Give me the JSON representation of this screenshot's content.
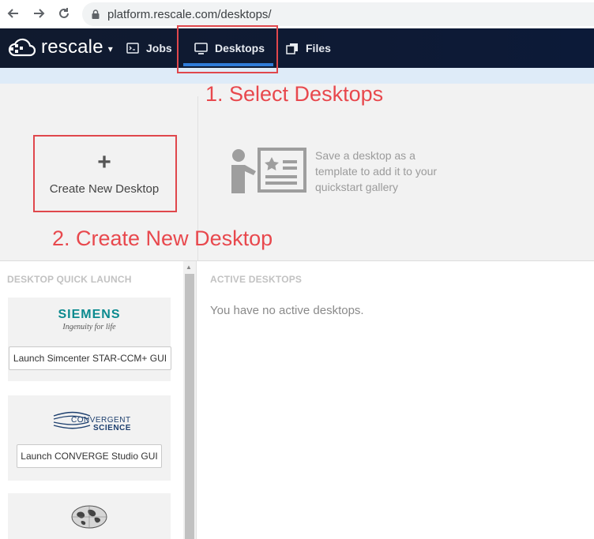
{
  "browser": {
    "url": "platform.rescale.com/desktops/",
    "icons": [
      "back-icon",
      "forward-icon",
      "reload-icon",
      "lock-icon"
    ]
  },
  "app": {
    "logo_text": "rescale",
    "caret": "▾",
    "nav": {
      "jobs": "Jobs",
      "desktops": "Desktops",
      "files": "Files"
    },
    "colors": {
      "nav_bg": "#0e1a34",
      "active_underline": "#2f7bd8",
      "annotation": "#e8484d"
    }
  },
  "top": {
    "plus": "+",
    "create_label": "Create New Desktop",
    "template_text": "Save a desktop as a template to add it to your quickstart gallery"
  },
  "annotations": {
    "step1": "1. Select Desktops",
    "step2": "2. Create New Desktop"
  },
  "quick_launch": {
    "title": "DESKTOP QUICK LAUNCH",
    "cards": [
      {
        "logo_name": "SIEMENS",
        "logo_tagline": "Ingenuity for life",
        "button": "Launch Simcenter STAR-CCM+ GUI"
      },
      {
        "logo_name": "CONVERGENT",
        "logo_sub": "SCIENCE",
        "button": "Launch CONVERGE Studio GUI"
      },
      {
        "logo_name": "globe-logo"
      }
    ]
  },
  "active": {
    "title": "ACTIVE DESKTOPS",
    "empty": "You have no active desktops."
  }
}
